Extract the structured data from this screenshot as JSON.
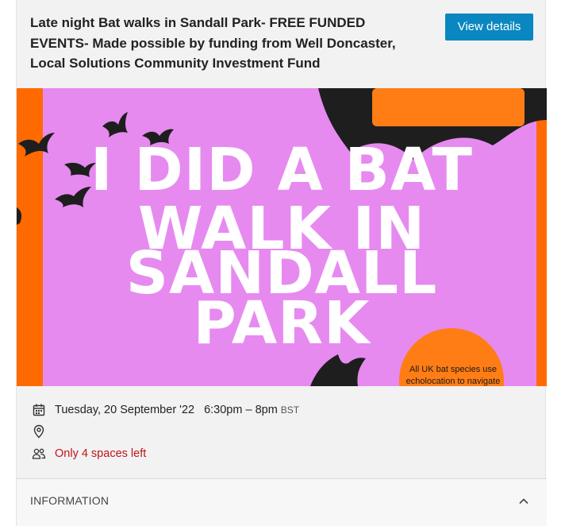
{
  "event": {
    "title": "Late night Bat walks in Sandall Park- FREE FUNDED EVENTS- Made possible by funding from Well Doncaster, Local Solutions Community Investment Fund",
    "view_details_label": "View details",
    "banner": {
      "lines": [
        "I DID A BAT",
        "WALK IN",
        "SANDALL",
        "PARK"
      ],
      "bubble_text": "All UK bat species use echolocation to navigate",
      "colors": {
        "background": "#ff6a00",
        "panel": "#e68af0",
        "text": "#ffffff",
        "bat": "#1e1e1e",
        "bubble": "#ff7d14"
      }
    },
    "date": "Tuesday, 20 September '22",
    "time": "6:30pm – 8pm",
    "timezone": "BST",
    "spaces_left": "Only 4 spaces left",
    "icons": {
      "date": "calendar-icon",
      "location": "location-pin-icon",
      "spaces": "people-icon",
      "toggle": "chevron-up-icon"
    }
  },
  "information": {
    "label": "INFORMATION"
  },
  "colors": {
    "accent": "#0a87c0",
    "warning": "#c0141a"
  }
}
